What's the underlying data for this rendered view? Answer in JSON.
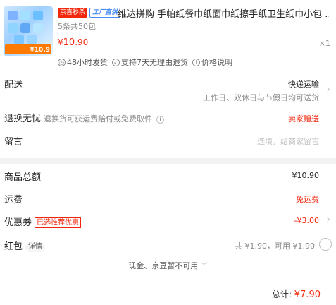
{
  "product": {
    "thumb_promo_price": "¥10.9",
    "tag_1": "京喜秒杀",
    "tag_2": "工厂直供",
    "title": "维达拼购 手帕纸餐巾纸面巾纸擦手纸卫生纸巾小包 ...",
    "spec": "5条共50包",
    "price_symbol": "¥",
    "price_int": "10",
    "price_dec": ".90",
    "qty": "×1",
    "services": [
      "48小时发货",
      "支持7天无理由退货",
      "价格说明"
    ]
  },
  "delivery": {
    "label": "配送",
    "method": "快递运输",
    "note": "工作日、双休日与节假日均可送货"
  },
  "returns": {
    "label": "退换无忧",
    "desc": "退换货可获运费赔付或免费取件",
    "value": "卖家赠送"
  },
  "message": {
    "label": "留言",
    "placeholder": "选填，给商家留言"
  },
  "summary": {
    "goods_total_label": "商品总额",
    "goods_total": "¥10.90",
    "freight_label": "运费",
    "freight": "免运费",
    "coupon_label": "优惠券",
    "coupon_tag": "已选推荐优惠",
    "coupon_value": "-¥3.00",
    "redpacket_label": "红包",
    "redpacket_tag": "详情",
    "redpacket_info": "共 ¥1.90，可用 ¥1.90",
    "unavailable_note": "现金、京豆暂不可用"
  },
  "footer": {
    "total_label": "总计:",
    "total_value": "¥7.90"
  },
  "colors": {
    "accent": "#f2270c",
    "blue": "#4a8ff7"
  },
  "icons": [
    "clock-icon",
    "shield-icon",
    "info-icon",
    "chevron-right-icon",
    "chevron-down-icon"
  ]
}
